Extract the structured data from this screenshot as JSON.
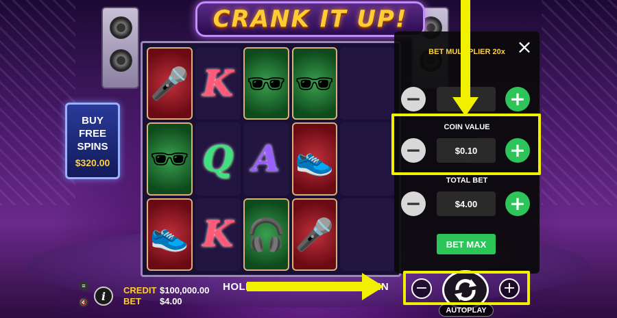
{
  "game": {
    "title": "CRANK IT UP!"
  },
  "buy_free_spins": {
    "label_line1": "BUY",
    "label_line2": "FREE",
    "label_line3": "SPINS",
    "price": "$320.00"
  },
  "reels": [
    [
      "microphone",
      "K",
      "glasses",
      "glasses"
    ],
    [
      "glasses",
      "Q",
      "A",
      "sneakers"
    ],
    [
      "sneakers",
      "K",
      "headphones",
      "microphone"
    ]
  ],
  "bet_panel": {
    "multiplier_label": "BET MULTIPLIER 20x",
    "multiplier_value": "",
    "coin_value_label": "COIN VALUE",
    "coin_value": "$0.10",
    "total_bet_label": "TOTAL BET",
    "total_bet": "$4.00",
    "bet_max_label": "BET MAX",
    "close_glyph": "×",
    "minus_glyph": "−",
    "plus_glyph": "+"
  },
  "bottom_bar": {
    "credit_label": "CREDIT",
    "credit_value": "$100,000.00",
    "bet_label": "BET",
    "bet_value": "$4.00",
    "hold_text": "HOLD SPACE FOR TURBO SPIN",
    "autoplay_label": "AUTOPLAY",
    "info_glyph": "i"
  },
  "colors": {
    "accent_yellow": "#f0f000",
    "green_button": "#2dc45a",
    "gold_text": "#ffcc33"
  }
}
